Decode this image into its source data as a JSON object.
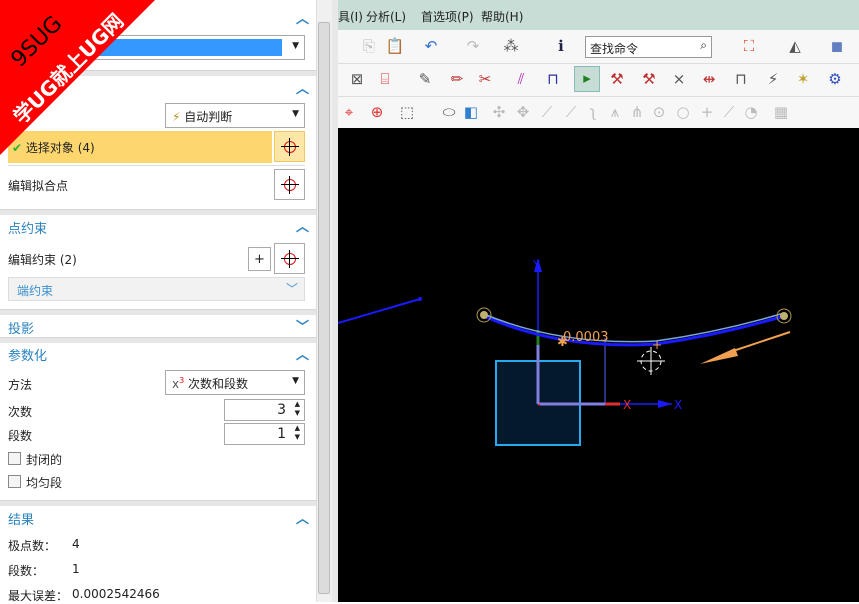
{
  "menu": [
    "具(I)",
    "分析(L)",
    "首选项(P)",
    "帮助(H)"
  ],
  "toolbar": {
    "search_placeholder": "查找命令"
  },
  "watermark": {
    "line1": "9SUG",
    "line2": "学UG就上UG网"
  },
  "panel": {
    "section_type": {
      "dropdown_value": ""
    },
    "section_points": {
      "snap_dropdown": "自动判断",
      "select_object": "选择对象 (4)",
      "edit_fit_points": "编辑拟合点"
    },
    "point_constraint": {
      "title": "点约束",
      "edit_constraint": "编辑约束 (2)",
      "end_constraint": "端约束"
    },
    "projection": {
      "title": "投影"
    },
    "parameterization": {
      "title": "参数化",
      "method_label": "方法",
      "method_value": "次数和段数",
      "method_icon": "x³",
      "degree_label": "次数",
      "degree_value": "3",
      "segments_label": "段数",
      "segments_value": "1",
      "closed_label": "封闭的",
      "closed": false,
      "uniform_label": "均匀段",
      "uniform": false
    },
    "results": {
      "title": "结果",
      "poles_label": "极点数：",
      "poles_value": "4",
      "segments_label": "段数：",
      "segments_value": "1",
      "max_error_label": "最大误差：",
      "max_error_value": "0.0002542466"
    }
  },
  "viewport": {
    "deviation_label": "0.0003",
    "axis_x": "X",
    "axis_y": "Y",
    "csys_x": "X"
  },
  "colors": {
    "accent": "#2a83c0",
    "selected_row": "#fdd76e",
    "menubar": "#c7ddd6",
    "curve": "#1a1aff"
  }
}
